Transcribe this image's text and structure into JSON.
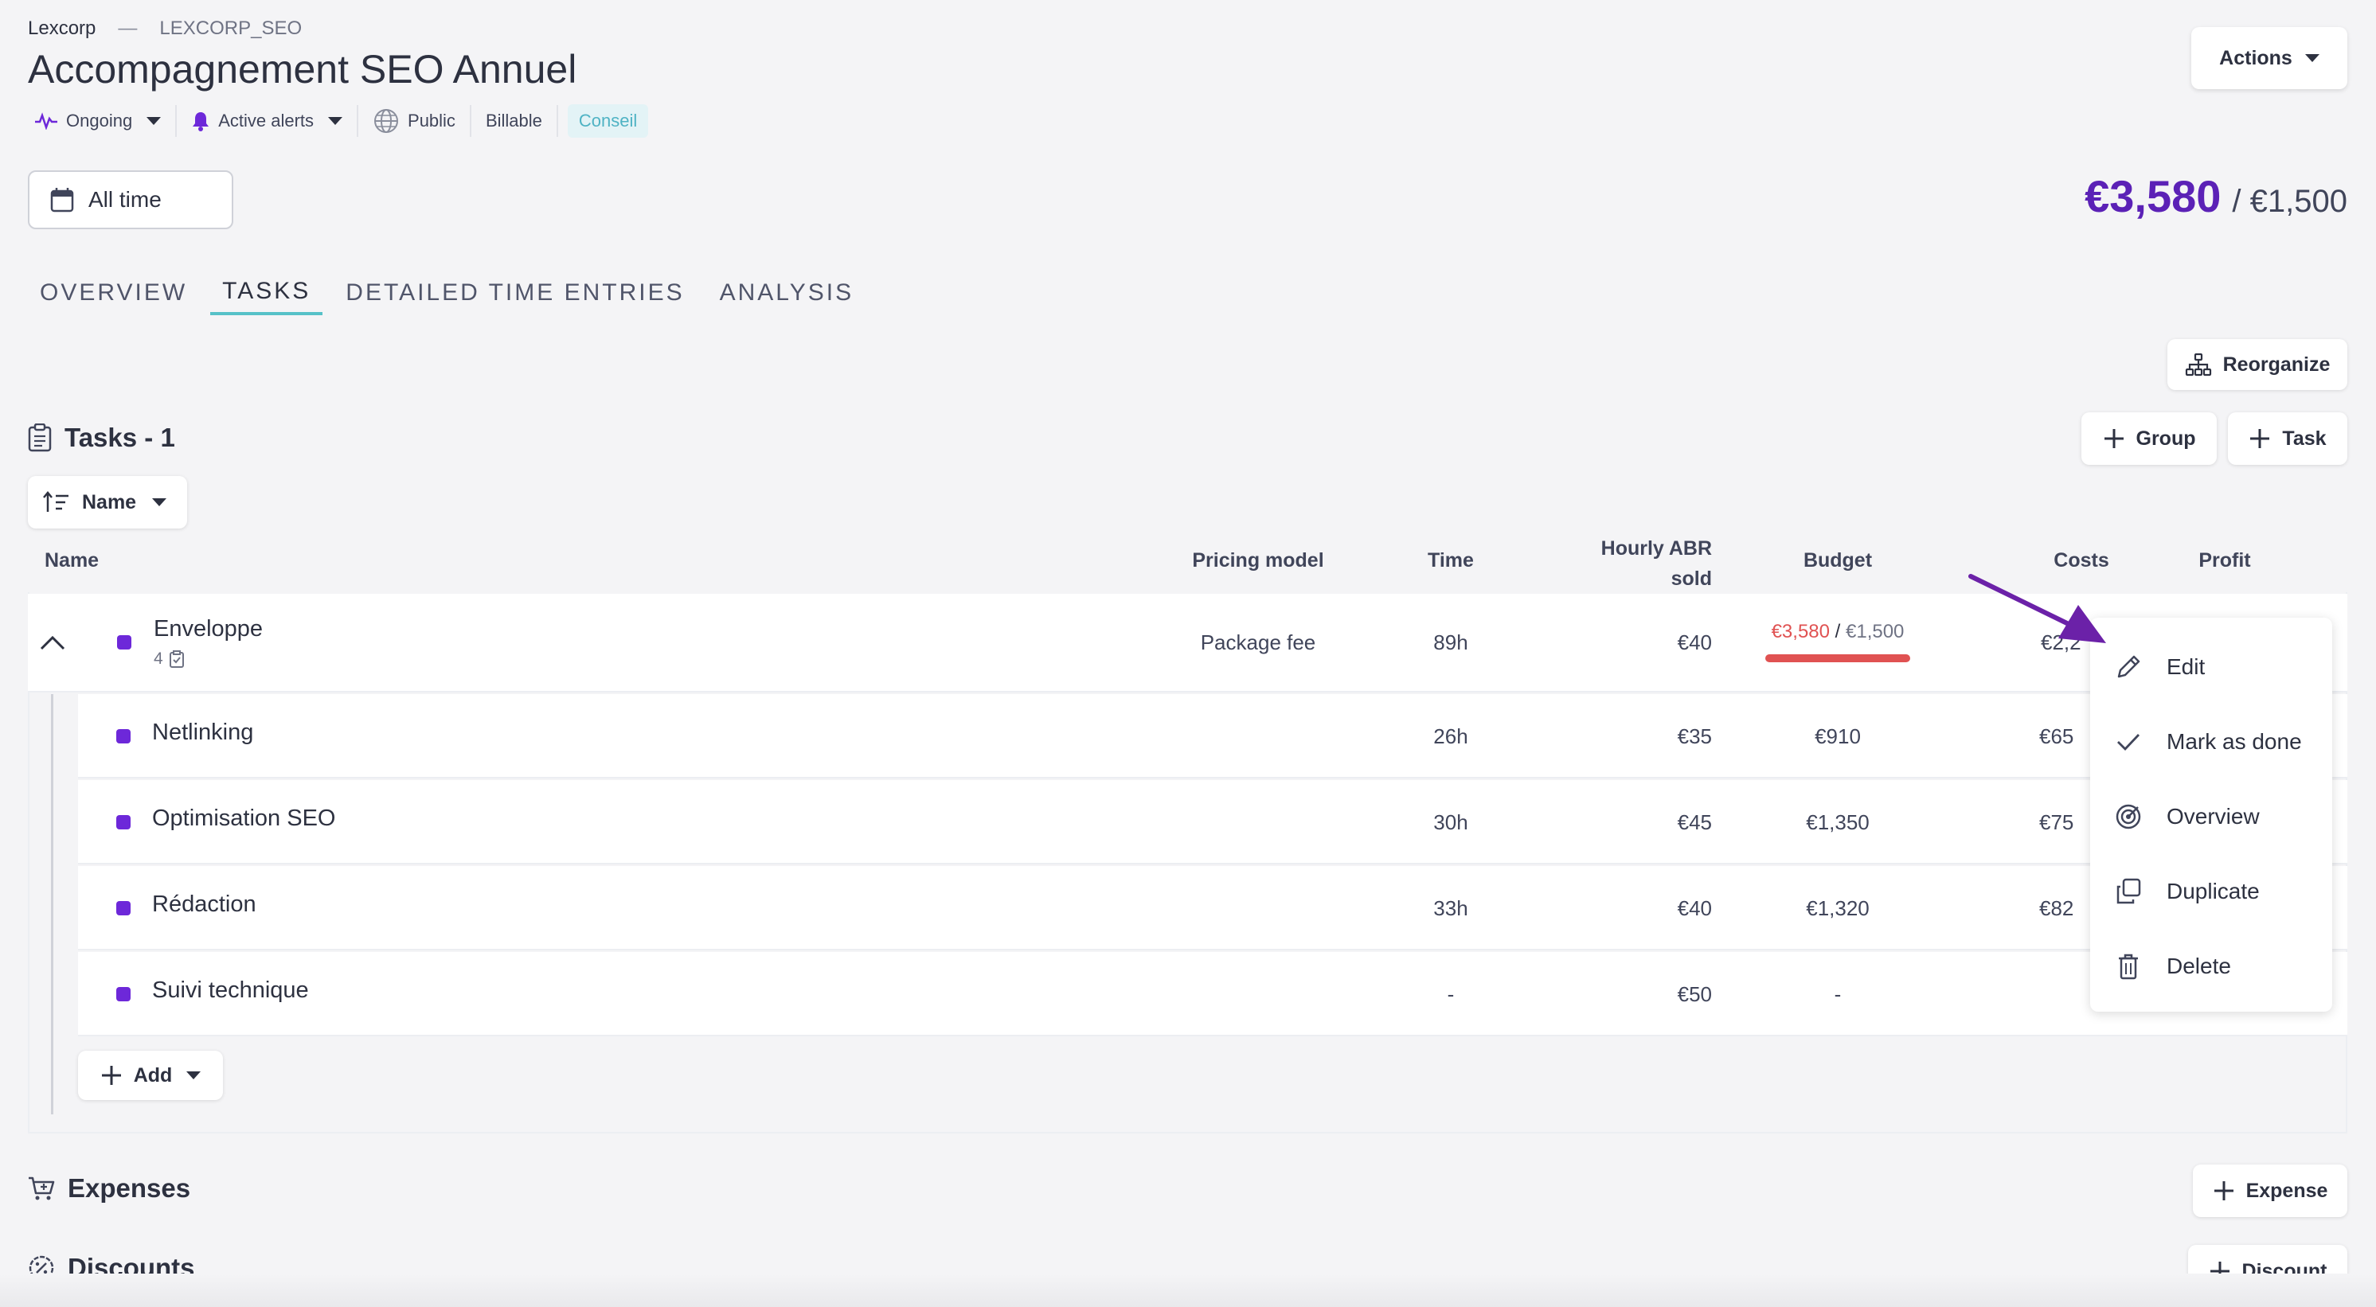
{
  "breadcrumb": {
    "client": "Lexcorp",
    "separator": "—",
    "code": "LEXCORP_SEO"
  },
  "project": {
    "title": "Accompagnement SEO Annuel"
  },
  "meta": {
    "status": "Ongoing",
    "alerts": "Active alerts",
    "visibility": "Public",
    "billable": "Billable",
    "category": "Conseil"
  },
  "header": {
    "actions_label": "Actions"
  },
  "filter": {
    "period": "All time"
  },
  "budget": {
    "spent": "€3,580",
    "total": "/ €1,500"
  },
  "tabs": [
    {
      "label": "OVERVIEW"
    },
    {
      "label": "TASKS"
    },
    {
      "label": "DETAILED TIME ENTRIES"
    },
    {
      "label": "ANALYSIS"
    }
  ],
  "toolbar": {
    "reorganize": "Reorganize",
    "group": "Group",
    "task": "Task"
  },
  "tasks_section": {
    "title": "Tasks - 1",
    "sort_label": "Name"
  },
  "columns": {
    "name": "Name",
    "pricing_model": "Pricing model",
    "time": "Time",
    "hourly_line1": "Hourly ABR",
    "hourly_line2": "sold",
    "budget": "Budget",
    "costs": "Costs",
    "profit": "Profit"
  },
  "parent_task": {
    "name": "Enveloppe",
    "subtask_count": "4",
    "pricing_model": "Package fee",
    "time": "89h",
    "hourly": "€40",
    "budget_spent": "€3,580",
    "budget_sep": "/",
    "budget_total": "€1,500",
    "costs": "€2,2"
  },
  "subtasks": [
    {
      "name": "Netlinking",
      "time": "26h",
      "hourly": "€35",
      "budget": "€910",
      "costs": "€65"
    },
    {
      "name": "Optimisation SEO",
      "time": "30h",
      "hourly": "€45",
      "budget": "€1,350",
      "costs": "€75"
    },
    {
      "name": "Rédaction",
      "time": "33h",
      "hourly": "€40",
      "budget": "€1,320",
      "costs": "€82"
    },
    {
      "name": "Suivi technique",
      "time": "-",
      "hourly": "€50",
      "budget": "-",
      "costs": ""
    }
  ],
  "add_button": "Add",
  "context_menu": [
    {
      "label": "Edit",
      "icon": "pencil-icon"
    },
    {
      "label": "Mark as done",
      "icon": "check-icon"
    },
    {
      "label": "Overview",
      "icon": "target-icon"
    },
    {
      "label": "Duplicate",
      "icon": "copy-icon"
    },
    {
      "label": "Delete",
      "icon": "trash-icon"
    }
  ],
  "expenses": {
    "title": "Expenses",
    "button": "Expense"
  },
  "discounts": {
    "title": "Discounts",
    "button": "Discount"
  },
  "colors": {
    "accent": "#5b21b6",
    "task_dot": "#6d28d9",
    "over_budget": "#e05252",
    "tab_underline": "#56c1c8",
    "annotation_arrow": "#6b21a8"
  }
}
